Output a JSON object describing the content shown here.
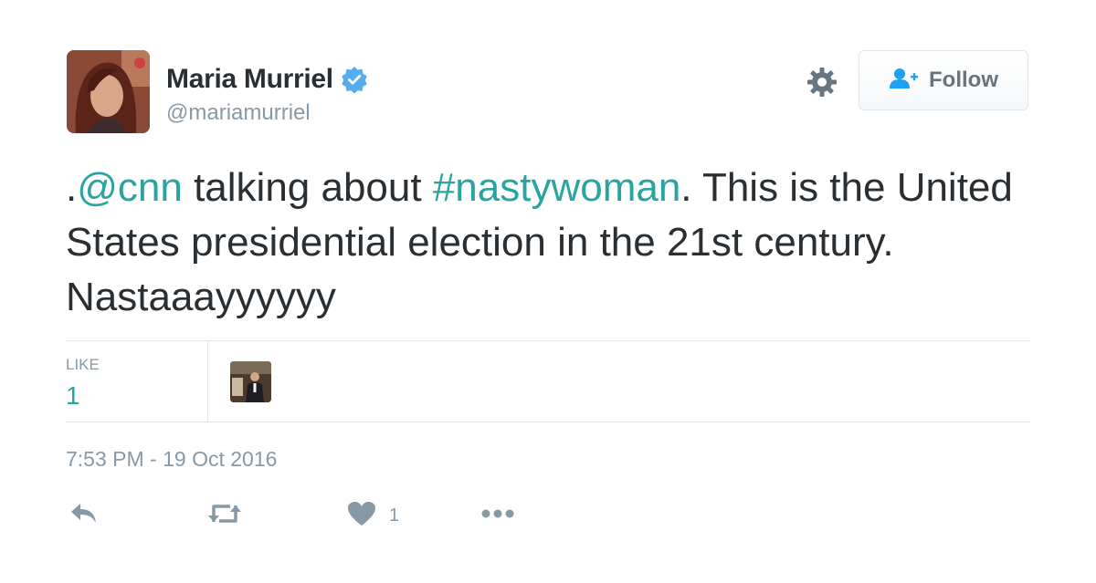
{
  "user": {
    "display_name": "Maria Murriel",
    "handle": "@mariamurriel",
    "verified_icon": "verified-badge-icon"
  },
  "header": {
    "follow_label": "Follow",
    "settings_icon": "gear-icon",
    "follow_icon": "add-user-icon"
  },
  "tweet": {
    "prefix": ".",
    "mention": "@cnn",
    "text_1": " talking about ",
    "hashtag": "#nastywoman",
    "text_2": ". This is the United States presidential election in the 21st century. Nastaaayyyyyy"
  },
  "stats": {
    "like_label": "LIKE",
    "like_count": "1"
  },
  "timestamp": "7:53 PM - 19 Oct 2016",
  "actions": {
    "reply_icon": "reply-icon",
    "retweet_icon": "retweet-icon",
    "like_icon": "heart-icon",
    "like_count": "1",
    "more_icon": "more-icon"
  },
  "colors": {
    "link": "#2aa4a0",
    "muted": "#8899a6",
    "verified": "#55acee",
    "text": "#292f33"
  }
}
